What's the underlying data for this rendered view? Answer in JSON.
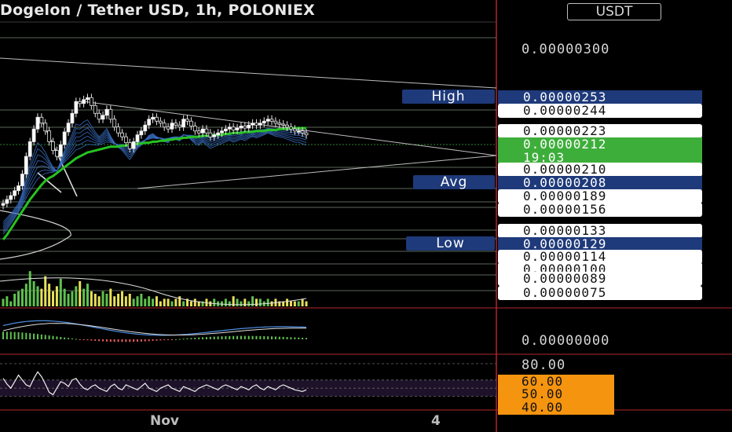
{
  "header": {
    "title": "Dogelon / Tether USD, 1h, POLONIEX",
    "currency": "USDT"
  },
  "colors": {
    "background": "#000000",
    "green_ma": "#27c221",
    "ribbon": "#3a6fc4",
    "volume_up": "#5fc24f",
    "volume_down": "#e8e05a",
    "navy_tag": "#1e3a7a",
    "orange_tag": "#f5940e",
    "last_price_tag": "#3eae3b",
    "separator_red": "#b3262d"
  },
  "price_axis": {
    "top_label": "0.00000300",
    "zero_label": "0.00000000",
    "tags": [
      {
        "value": "0.00000253",
        "style": "navy",
        "marker": "High"
      },
      {
        "value": "0.00000244",
        "style": "white"
      },
      {
        "value": "0.00000223",
        "style": "white"
      },
      {
        "value": "0.00000212",
        "style": "green",
        "sub": "19:03"
      },
      {
        "value": "0.00000210",
        "style": "white"
      },
      {
        "value": "0.00000208",
        "style": "navy",
        "marker": "Avg"
      },
      {
        "value": "0.00000189",
        "style": "white"
      },
      {
        "value": "0.00000156",
        "style": "white"
      },
      {
        "value": "0.00000133",
        "style": "white"
      },
      {
        "value": "0.00000129",
        "style": "navy",
        "marker": "Low"
      },
      {
        "value": "0.00000114",
        "style": "white"
      },
      {
        "value": "0.00000100",
        "style": "white"
      },
      {
        "value": "0.00000089",
        "style": "white"
      },
      {
        "value": "0.00000075",
        "style": "white"
      }
    ]
  },
  "rsi_axis": {
    "labels": [
      "80.00",
      "60.00",
      "50.00",
      "40.00"
    ]
  },
  "time_axis": {
    "labels": [
      "Nov",
      "4"
    ]
  },
  "chart_data": {
    "type": "line",
    "title": "Dogelon / Tether USD, 1h, POLONIEX",
    "ylim": [
      0.0,
      3e-06
    ],
    "x": [
      0,
      1,
      2,
      3,
      4,
      5,
      6,
      7,
      8,
      9,
      10,
      11,
      12,
      13,
      14,
      15,
      16,
      17,
      18,
      19,
      20,
      21,
      22,
      23,
      24,
      25,
      26,
      27,
      28,
      29,
      30,
      31,
      32,
      33,
      34,
      35,
      36,
      37,
      38,
      39,
      40,
      41,
      42,
      43,
      44,
      45,
      46,
      47,
      48,
      49,
      50,
      51,
      52,
      53,
      54,
      55,
      56,
      57,
      58,
      59,
      60,
      61,
      62,
      63,
      64,
      65,
      66,
      67,
      68,
      69,
      70,
      71,
      72,
      73,
      74,
      75,
      76,
      77,
      78,
      79
    ],
    "series": [
      {
        "values": [
          1.42,
          1.46,
          1.5,
          1.55,
          1.6,
          1.72,
          1.9,
          2.05,
          2.18,
          2.3,
          2.24,
          2.16,
          2.05,
          1.96,
          1.9,
          2.02,
          2.15,
          2.24,
          2.34,
          2.46,
          2.44,
          2.48,
          2.5,
          2.42,
          2.34,
          2.28,
          2.32,
          2.38,
          2.28,
          2.2,
          2.14,
          2.1,
          2.04,
          1.98,
          2.05,
          2.12,
          2.16,
          2.22,
          2.28,
          2.3,
          2.26,
          2.24,
          2.2,
          2.18,
          2.24,
          2.22,
          2.2,
          2.28,
          2.26,
          2.21,
          2.16,
          2.14,
          2.18,
          2.14,
          2.1,
          2.12,
          2.14,
          2.16,
          2.18,
          2.2,
          2.17,
          2.19,
          2.21,
          2.19,
          2.22,
          2.24,
          2.22,
          2.24,
          2.26,
          2.28,
          2.26,
          2.24,
          2.23,
          2.22,
          2.2,
          2.18,
          2.16,
          2.16,
          2.14,
          2.12
        ]
      },
      {
        "values": [
          1.05,
          1.1,
          1.16,
          1.22,
          1.28,
          1.34,
          1.4,
          1.46,
          1.51,
          1.56,
          1.61,
          1.65,
          1.68,
          1.7,
          1.73,
          1.76,
          1.79,
          1.82,
          1.85,
          1.88,
          1.9,
          1.92,
          1.94,
          1.95,
          1.96,
          1.97,
          1.98,
          1.99,
          2.0,
          2.0,
          2.0,
          2.01,
          2.01,
          2.02,
          2.02,
          2.03,
          2.03,
          2.04,
          2.04,
          2.05,
          2.05,
          2.06,
          2.06,
          2.07,
          2.07,
          2.08,
          2.08,
          2.09,
          2.09,
          2.1,
          2.1,
          2.1,
          2.11,
          2.11,
          2.11,
          2.12,
          2.12,
          2.12,
          2.13,
          2.13,
          2.14,
          2.14,
          2.14,
          2.15,
          2.15,
          2.15,
          2.16,
          2.16,
          2.16,
          2.17,
          2.17,
          2.17,
          2.18,
          2.18,
          2.18,
          2.19,
          2.19,
          2.19,
          2.19,
          2.19
        ]
      }
    ],
    "volume": [
      3,
      4,
      2,
      5,
      6,
      7,
      9,
      14,
      10,
      8,
      7,
      12,
      9,
      6,
      8,
      11,
      7,
      5,
      6,
      8,
      10,
      7,
      9,
      6,
      5,
      4,
      6,
      5,
      7,
      4,
      5,
      6,
      4,
      5,
      3,
      4,
      5,
      3,
      4,
      3,
      4,
      2,
      3,
      3,
      2,
      3,
      4,
      2,
      3,
      2,
      3,
      2,
      2,
      3,
      2,
      3,
      2,
      2,
      3,
      2,
      4,
      3,
      2,
      3,
      2,
      4,
      3,
      3,
      2,
      3,
      2,
      3,
      2,
      2,
      3,
      2,
      2,
      2,
      3,
      2
    ],
    "rsi": [
      62,
      55,
      50,
      58,
      66,
      60,
      54,
      52,
      62,
      70,
      64,
      55,
      45,
      42,
      50,
      58,
      56,
      52,
      60,
      62,
      55,
      50,
      48,
      52,
      54,
      50,
      48,
      46,
      52,
      55,
      50,
      48,
      54,
      52,
      50,
      48,
      52,
      56,
      50,
      48,
      46,
      50,
      52,
      54,
      50,
      48,
      46,
      52,
      50,
      48,
      46,
      50,
      52,
      54,
      52,
      50,
      48,
      52,
      54,
      52,
      50,
      48,
      52,
      50,
      48,
      52,
      54,
      50,
      48,
      52,
      50,
      48,
      52,
      54,
      52,
      50,
      48,
      47,
      46,
      48
    ],
    "rsi_levels": [
      80,
      60,
      50,
      40
    ]
  }
}
